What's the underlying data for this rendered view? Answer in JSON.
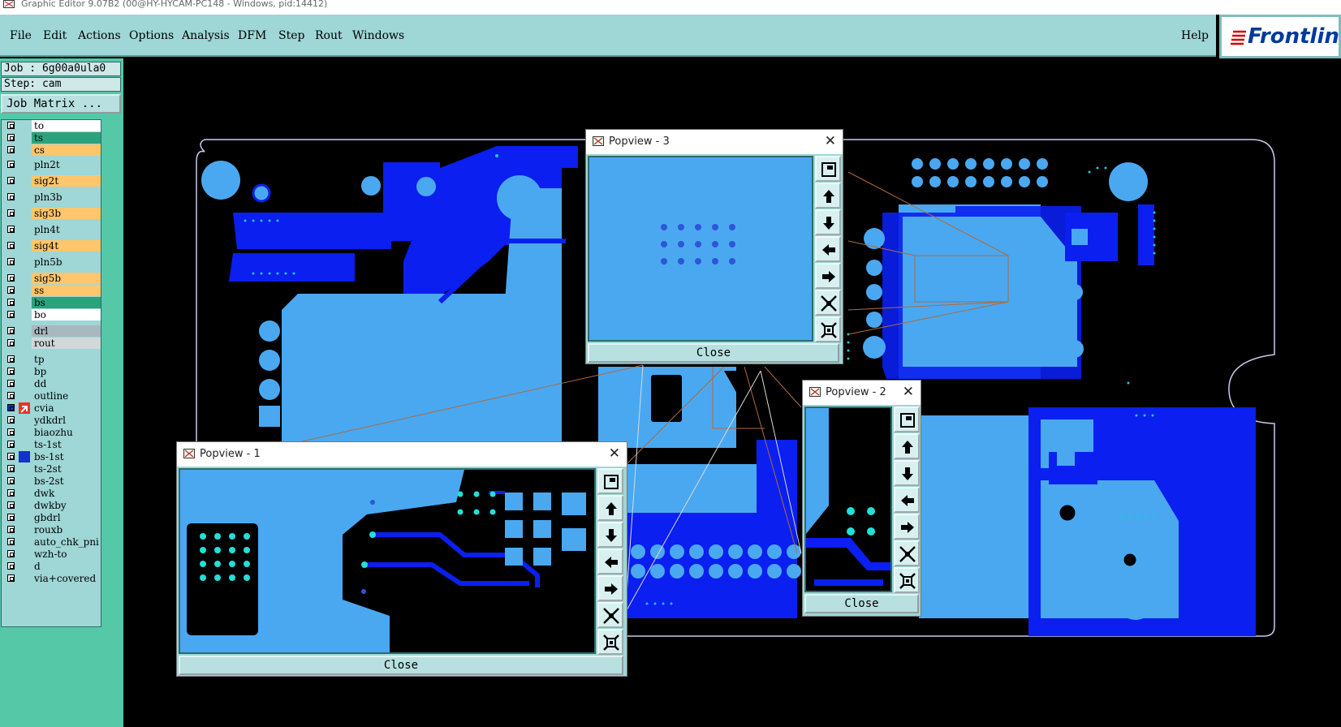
{
  "window_title": "Graphic Editor 9.07B2 (00@HY-HYCAM-PC148 - Windows, pid:14412)",
  "menu": {
    "file": "File",
    "edit": "Edit",
    "actions": "Actions",
    "options": "Options",
    "analysis": "Analysis",
    "dfm": "DFM",
    "step": "Step",
    "rout": "Rout",
    "windows": "Windows",
    "help": "Help"
  },
  "logo_text": "Frontline",
  "job": {
    "job_label": "Job : 6g00a0ula0",
    "step_label": "Step: cam",
    "matrix_button": "Job Matrix ..."
  },
  "layers": [
    {
      "name": "to",
      "color": "#ffffff"
    },
    {
      "name": "ts",
      "color": "#2aa37c"
    },
    {
      "name": "cs",
      "color": "#ffc66b"
    },
    {
      "name": "pln2t",
      "color": "#9fd6d6"
    },
    {
      "name": "sig2t",
      "color": "#ffc66b"
    },
    {
      "name": "pln3b",
      "color": "#9fd6d6"
    },
    {
      "name": "sig3b",
      "color": "#ffc66b"
    },
    {
      "name": "pln4t",
      "color": "#9fd6d6"
    },
    {
      "name": "sig4t",
      "color": "#ffc66b"
    },
    {
      "name": "pln5b",
      "color": "#9fd6d6"
    },
    {
      "name": "sig5b",
      "color": "#ffc66b"
    },
    {
      "name": "ss",
      "color": "#ffc66b"
    },
    {
      "name": "bs",
      "color": "#2aa37c"
    },
    {
      "name": "bo",
      "color": "#ffffff"
    },
    {
      "name": "drl",
      "color": "#a8b8be"
    },
    {
      "name": "rout",
      "color": "#d0d8d8"
    },
    {
      "name": "tp",
      "color": "#9fd6d6"
    },
    {
      "name": "bp",
      "color": "#9fd6d6"
    },
    {
      "name": "dd",
      "color": "#9fd6d6"
    },
    {
      "name": "outline",
      "color": "#9fd6d6"
    },
    {
      "name": "cvia",
      "color": "#9fd6d6",
      "active": true
    },
    {
      "name": "ydkdrl",
      "color": "#9fd6d6"
    },
    {
      "name": "biaozhu",
      "color": "#9fd6d6"
    },
    {
      "name": "ts-1st",
      "color": "#9fd6d6"
    },
    {
      "name": "bs-1st",
      "color": "#9fd6d6",
      "marker": "#1133cc"
    },
    {
      "name": "ts-2st",
      "color": "#9fd6d6"
    },
    {
      "name": "bs-2st",
      "color": "#9fd6d6"
    },
    {
      "name": "dwk",
      "color": "#9fd6d6"
    },
    {
      "name": "dwkby",
      "color": "#9fd6d6"
    },
    {
      "name": "gbdrl",
      "color": "#9fd6d6"
    },
    {
      "name": "rouxb",
      "color": "#9fd6d6"
    },
    {
      "name": "auto_chk_pni",
      "color": "#9fd6d6"
    },
    {
      "name": "wzh-to",
      "color": "#9fd6d6"
    },
    {
      "name": "d",
      "color": "#9fd6d6"
    },
    {
      "name": "via+covered",
      "color": "#9fd6d6"
    }
  ],
  "popups": {
    "p3": {
      "title": "Popview - 3",
      "close": "Close"
    },
    "p2": {
      "title": "Popview - 2",
      "close": "Close"
    },
    "p1": {
      "title": "Popview - 1",
      "close": "Close"
    }
  },
  "toolbar_icons": [
    "zoom-home-icon",
    "pan-up-icon",
    "pan-down-icon",
    "pan-left-icon",
    "pan-right-icon",
    "zoom-out-icon",
    "zoom-in-icon"
  ],
  "colors": {
    "board_light": "#4aa8f0",
    "board_dark": "#0a1ff0",
    "menu_bg": "#9fd6d6",
    "panel_bg": "#55c8a8"
  }
}
